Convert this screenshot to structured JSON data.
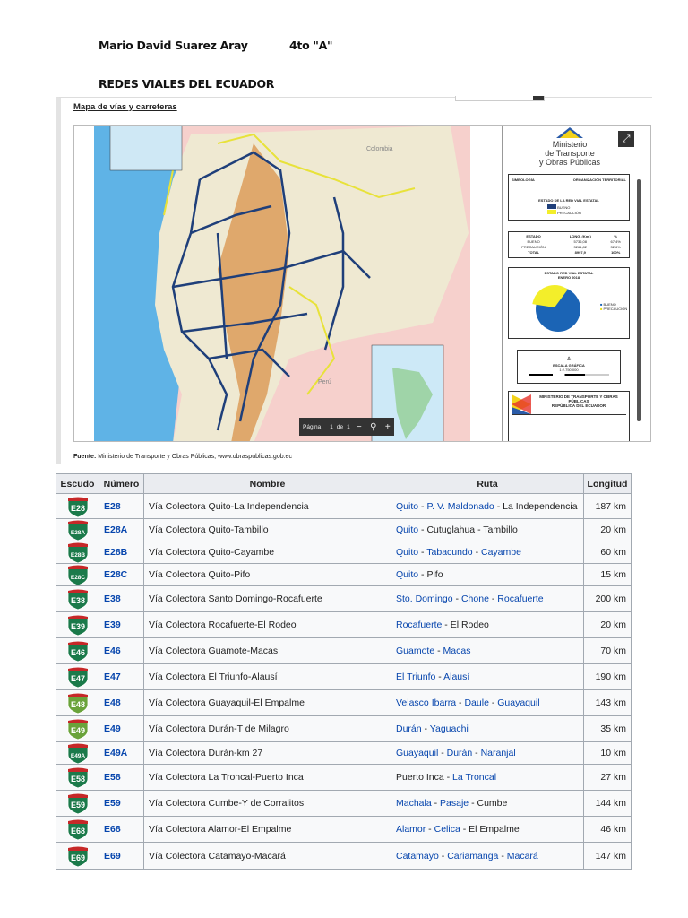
{
  "header": {
    "author": "Mario David Suarez Aray",
    "grade": "4to \"A\"",
    "title": "REDES VIALES DEL ECUADOR"
  },
  "map": {
    "title": "Mapa de vías y carreteras",
    "labels": {
      "colombia": "Colombia",
      "peru": "Perú"
    },
    "ministry": [
      "Ministerio",
      "de Transporte",
      "y Obras Públicas"
    ],
    "legend": {
      "simbologia": "SIMBOLOGÍA",
      "organizacion": "ORGANIZACIÓN TERRITORIAL",
      "estado_red": "ESTADO DE LA RED VIAL ESTATAL",
      "bueno": "BUENO",
      "precaucion": "PRECAUCIÓN"
    },
    "stats": {
      "headers": [
        "ESTADO",
        "LONG. (Km.)",
        "%"
      ],
      "rows": [
        [
          "BUENO",
          "5736,08",
          "67,4%"
        ],
        [
          "PRECAUCIÓN",
          "3261,82",
          "32,6%"
        ],
        [
          "TOTAL",
          "8997,9",
          "100%"
        ]
      ]
    },
    "pie": {
      "title": "ESTADO RED VIAL ESTATAL",
      "subtitle": "ENERO 2018",
      "bueno_pct": 67.4,
      "precaucion_pct": 32.6
    },
    "scale": {
      "title": "ESCALA GRÁFICA",
      "ratio": "1:2.750.000"
    },
    "footer_title": "MINISTERIO DE TRANSPORTE Y OBRAS PÚBLICAS",
    "footer_subtitle": "REPÚBLICA DEL ECUADOR",
    "pager": {
      "label": "Página",
      "current": "1",
      "of": "de",
      "total": "1"
    },
    "source_label": "Fuente:",
    "source_text": "Ministerio de Transporte y Obras Públicas, www.obraspublicas.gob.ec",
    "colors": {
      "ocean": "#5fb3e6",
      "land": "#efe9d2",
      "peru": "#f6d0cc",
      "andes": "#d9924a",
      "road_good": "#1f3f7a",
      "road_caution": "#e8e23a"
    }
  },
  "table": {
    "headers": [
      "Escudo",
      "Número",
      "Nombre",
      "Ruta",
      "Longitud"
    ],
    "rows": [
      {
        "shield": "E28",
        "num": "E28",
        "name": "Vía Colectora Quito-La Independencia",
        "route": [
          {
            "t": "Quito",
            "l": true
          },
          {
            "t": " - ",
            "l": false
          },
          {
            "t": "P. V. Maldonado",
            "l": true
          },
          {
            "t": " - La Independencia",
            "l": false
          }
        ],
        "len": "187 km"
      },
      {
        "shield": "E28A",
        "num": "E28A",
        "name": "Vía Colectora Quito-Tambillo",
        "route": [
          {
            "t": "Quito",
            "l": true
          },
          {
            "t": " - Cutuglahua - Tambillo",
            "l": false
          }
        ],
        "len": "20 km"
      },
      {
        "shield": "E28B",
        "num": "E28B",
        "name": "Vía Colectora Quito-Cayambe",
        "route": [
          {
            "t": "Quito",
            "l": true
          },
          {
            "t": " - ",
            "l": false
          },
          {
            "t": "Tabacundo",
            "l": true
          },
          {
            "t": " - ",
            "l": false
          },
          {
            "t": "Cayambe",
            "l": true
          }
        ],
        "len": "60 km"
      },
      {
        "shield": "E28C",
        "num": "E28C",
        "name": "Vía Colectora Quito-Pifo",
        "route": [
          {
            "t": "Quito",
            "l": true
          },
          {
            "t": " - Pifo",
            "l": false
          }
        ],
        "len": "15 km"
      },
      {
        "shield": "E38",
        "num": "E38",
        "name": "Vía Colectora Santo Domingo-Rocafuerte",
        "route": [
          {
            "t": "Sto. Domingo",
            "l": true
          },
          {
            "t": " - ",
            "l": false
          },
          {
            "t": "Chone",
            "l": true
          },
          {
            "t": " - ",
            "l": false
          },
          {
            "t": "Rocafuerte",
            "l": true
          }
        ],
        "len": "200 km"
      },
      {
        "shield": "E39",
        "num": "E39",
        "name": "Vía Colectora Rocafuerte-El Rodeo",
        "route": [
          {
            "t": "Rocafuerte",
            "l": true
          },
          {
            "t": " - El Rodeo",
            "l": false
          }
        ],
        "len": "20 km"
      },
      {
        "shield": "E46",
        "num": "E46",
        "name": "Vía Colectora Guamote-Macas",
        "route": [
          {
            "t": "Guamote",
            "l": true
          },
          {
            "t": " - ",
            "l": false
          },
          {
            "t": "Macas",
            "l": true
          }
        ],
        "len": "70 km"
      },
      {
        "shield": "E47",
        "num": "E47",
        "name": "Vía Colectora El Triunfo-Alausí",
        "route": [
          {
            "t": "El Triunfo",
            "l": true
          },
          {
            "t": " - ",
            "l": false
          },
          {
            "t": "Alausí",
            "l": true
          }
        ],
        "len": "190 km"
      },
      {
        "shield": "E48",
        "num": "E48",
        "name": "Vía Colectora Guayaquil-El Empalme",
        "route": [
          {
            "t": "Velasco Ibarra",
            "l": true
          },
          {
            "t": " - ",
            "l": false
          },
          {
            "t": "Daule",
            "l": true
          },
          {
            "t": " - ",
            "l": false
          },
          {
            "t": "Guayaquil",
            "l": true
          }
        ],
        "len": "143 km",
        "light": true
      },
      {
        "shield": "E49",
        "num": "E49",
        "name": "Vía Colectora Durán-T de Milagro",
        "route": [
          {
            "t": "Durán",
            "l": true
          },
          {
            "t": " - ",
            "l": false
          },
          {
            "t": "Yaguachi",
            "l": true
          }
        ],
        "len": "35 km",
        "light": true
      },
      {
        "shield": "E49A",
        "num": "E49A",
        "name": "Vía Colectora Durán-km 27",
        "route": [
          {
            "t": "Guayaquil",
            "l": true
          },
          {
            "t": " - ",
            "l": false
          },
          {
            "t": "Durán",
            "l": true
          },
          {
            "t": " - ",
            "l": false
          },
          {
            "t": "Naranjal",
            "l": true
          }
        ],
        "len": "10 km"
      },
      {
        "shield": "E58",
        "num": "E58",
        "name": "Vía Colectora La Troncal-Puerto Inca",
        "route": [
          {
            "t": "Puerto Inca - ",
            "l": false
          },
          {
            "t": "La Troncal",
            "l": true
          }
        ],
        "len": "27 km"
      },
      {
        "shield": "E59",
        "num": "E59",
        "name": "Vía Colectora Cumbe-Y de Corralitos",
        "route": [
          {
            "t": "Machala",
            "l": true
          },
          {
            "t": " - ",
            "l": false
          },
          {
            "t": "Pasaje",
            "l": true
          },
          {
            "t": " - Cumbe",
            "l": false
          }
        ],
        "len": "144 km"
      },
      {
        "shield": "E68",
        "num": "E68",
        "name": "Vía Colectora Alamor-El Empalme",
        "route": [
          {
            "t": "Alamor",
            "l": true
          },
          {
            "t": " - ",
            "l": false
          },
          {
            "t": "Celica",
            "l": true
          },
          {
            "t": " - El Empalme",
            "l": false
          }
        ],
        "len": "46 km"
      },
      {
        "shield": "E69",
        "num": "E69",
        "name": "Vía Colectora Catamayo-Macará",
        "route": [
          {
            "t": "Catamayo",
            "l": true
          },
          {
            "t": " - ",
            "l": false
          },
          {
            "t": "Cariamanga",
            "l": true
          },
          {
            "t": " - ",
            "l": false
          },
          {
            "t": "Macará",
            "l": true
          }
        ],
        "len": "147 km"
      }
    ]
  }
}
